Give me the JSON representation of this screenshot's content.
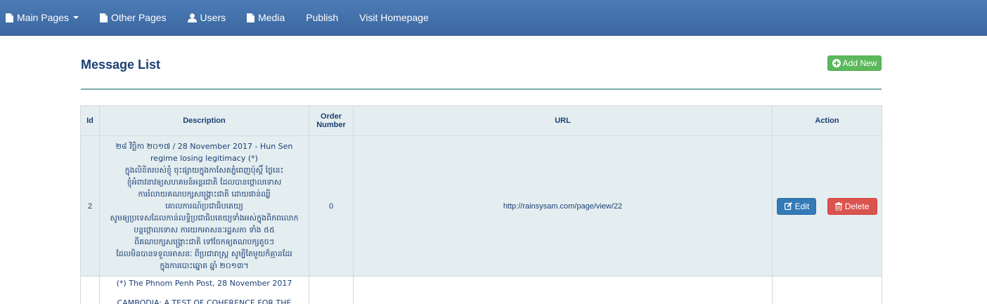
{
  "nav": {
    "main_pages": "Main Pages",
    "other_pages": "Other Pages",
    "users": "Users",
    "media": "Media",
    "publish": "Publish",
    "visit_homepage": "Visit Homepage"
  },
  "page": {
    "title": "Message List",
    "add_new": "Add New"
  },
  "table": {
    "headers": [
      "Id",
      "Description",
      "Order Number",
      "URL",
      "Action"
    ],
    "rows": [
      {
        "id": "2",
        "description_lines": [
          "២៨ វិច្ឆិកា ២០១៧ / 28 November 2017 - Hun Sen",
          "regime losing legitimacy (*)",
          "ក្នុងលិខិតរបស់ខ្ញុំ ចុះផ្សាយក្នុងកាសែតភ្នំពេញប៉ុស្តិ៍ ថ្ងៃនេះ",
          "ខ្ញុំអំពាវនាវឲ្យសហគមន៍អន្តរជាតិ ដែលបានថ្កោលទោស",
          "ការរំលាយគណបក្សសង្គ្រោះជាតិ ដោយផាន់ឈ្លី",
          "គោលការណ៍ប្រជាធិបតេយ្យ",
          "សូមឲ្យប្រទេសដែលកាន់លទ្ធិប្រជាធិបតេយ្យទាំងអស់ក្នុងពិភពលោក",
          "បន្តថ្កោលទោស ការយកអាសនៈរដ្ឋសភា ទាំង ៥៥",
          "ពីគណបក្សសង្គ្រោះជាតិ ទៅចែកឲ្យគណបក្សតូចៗ",
          "ដែលមិនបានទទួលអាសនៈ ពីប្រជារាស្ត្រ សូម្បីតែមួយក៏គ្មានដែរ",
          "ក្នុងការបោះឆ្នោត ឆ្នាំ ២០១៣។"
        ],
        "order_number": "0",
        "url": "http://rainsysam.com/page/view/22",
        "edit_label": "Edit",
        "delete_label": "Delete"
      },
      {
        "id": "",
        "description_lines": [
          "(*) The Phnom Penh Post, 28 November 2017",
          "CAMBODIA: A TEST OF COHERENCE FOR THE"
        ],
        "order_number": "",
        "url": ""
      }
    ]
  },
  "colors": {
    "navbar": "#3b67a0",
    "title": "#1c3f74",
    "add_button": "#5cb85c",
    "edit_button": "#337ab7",
    "delete_button": "#d9534f",
    "header_bg": "#e4eef0",
    "rule": "#7aaca8"
  },
  "icons": {
    "main_pages": "file-icon",
    "other_pages": "file-icon",
    "users": "user-icon",
    "media": "file-icon",
    "add_new": "plus-circle-icon",
    "edit": "edit-icon",
    "delete": "trash-icon"
  }
}
